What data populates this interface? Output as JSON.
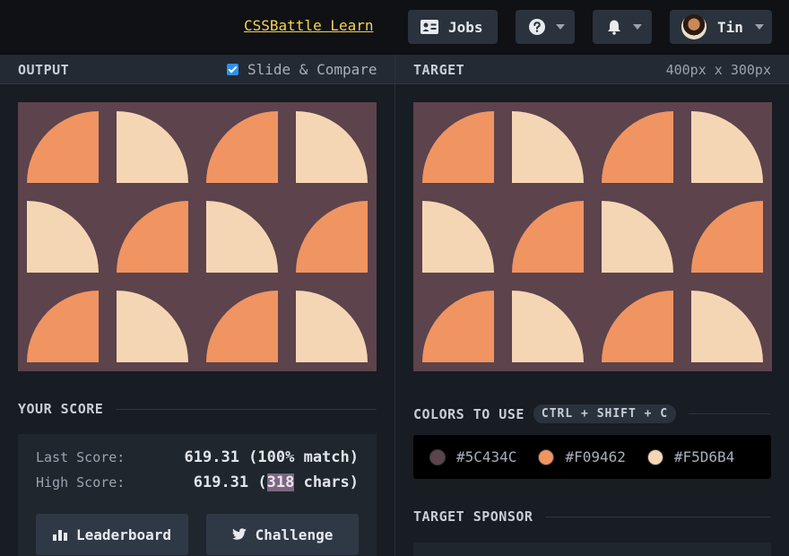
{
  "topbar": {
    "learn_link": "CSSBattle Learn",
    "jobs_label": "Jobs",
    "user_name": "Tin",
    "icons": [
      "jobs-card-icon",
      "help-icon",
      "bell-icon",
      "avatar"
    ]
  },
  "output": {
    "title": "OUTPUT",
    "slide_compare_label": "Slide & Compare",
    "slide_compare_checked": true
  },
  "target": {
    "title": "TARGET",
    "dimensions": "400px x 300px"
  },
  "score": {
    "title": "YOUR SCORE",
    "last_label": "Last Score:",
    "last_value": "619.31 (100% match)",
    "high_label": "High Score:",
    "high_prefix": "619.31 (",
    "high_chars": "318",
    "high_suffix": " chars)",
    "leaderboard_label": "Leaderboard",
    "challenge_label": "Challenge"
  },
  "colors": {
    "title": "COLORS TO USE",
    "shortcut": "CTRL + SHIFT + C",
    "swatches": [
      {
        "hex": "#5C434C",
        "color": "#5c434c"
      },
      {
        "hex": "#F09462",
        "color": "#f09462"
      },
      {
        "hex": "#F5D6B4",
        "color": "#f5d6b4"
      }
    ]
  },
  "sponsor": {
    "title": "TARGET SPONSOR"
  },
  "palette": {
    "background": "#5c434c",
    "orange": "#f09462",
    "cream": "#f5d6b4"
  }
}
